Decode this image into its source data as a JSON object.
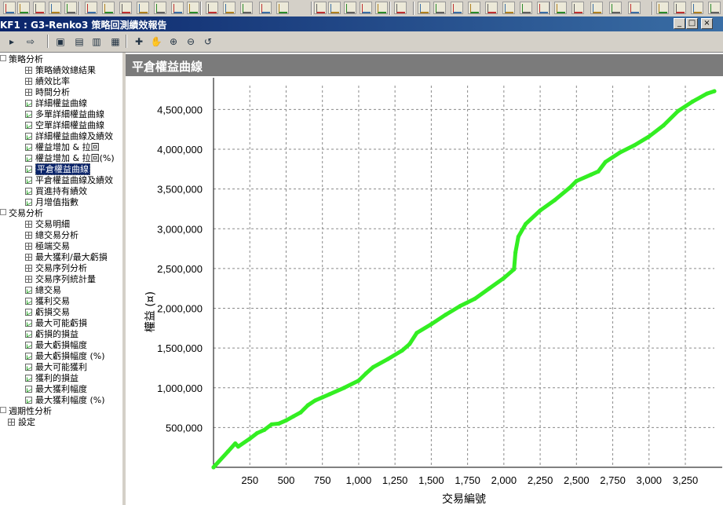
{
  "window": {
    "title": "KF1 : G3-Renko3 策略回測績效報告",
    "buttons": [
      "_",
      "□",
      "×"
    ]
  },
  "tree": {
    "items": [
      {
        "label": "策略分析",
        "level": 0,
        "icon": "expand-minus"
      },
      {
        "label": "策略績效總結果",
        "level": 1,
        "icon": "grid-icon"
      },
      {
        "label": "績效比率",
        "level": 1,
        "icon": "grid-icon"
      },
      {
        "label": "時間分析",
        "level": 1,
        "icon": "grid-icon"
      },
      {
        "label": "詳細權益曲線",
        "level": 1,
        "icon": "chart-icon"
      },
      {
        "label": "多單詳細權益曲線",
        "level": 1,
        "icon": "chart-icon"
      },
      {
        "label": "空單詳細權益曲線",
        "level": 1,
        "icon": "chart-icon"
      },
      {
        "label": "詳細權益曲線及績效",
        "level": 1,
        "icon": "chart-icon"
      },
      {
        "label": "權益增加 & 拉回",
        "level": 1,
        "icon": "chart-icon"
      },
      {
        "label": "權益增加 & 拉回(%)",
        "level": 1,
        "icon": "chart-icon"
      },
      {
        "label": "平倉權益曲線",
        "level": 1,
        "icon": "chart-icon",
        "selected": true
      },
      {
        "label": "平倉權益曲線及績效",
        "level": 1,
        "icon": "chart-icon"
      },
      {
        "label": "買進持有績效",
        "level": 1,
        "icon": "chart-icon"
      },
      {
        "label": "月增值指數",
        "level": 1,
        "icon": "chart-icon"
      },
      {
        "label": "交易分析",
        "level": 0,
        "icon": "expand-minus"
      },
      {
        "label": "交易明細",
        "level": 1,
        "icon": "grid-icon"
      },
      {
        "label": "總交易分析",
        "level": 1,
        "icon": "grid-icon"
      },
      {
        "label": "極端交易",
        "level": 1,
        "icon": "grid-icon"
      },
      {
        "label": "最大獲利/最大虧損",
        "level": 1,
        "icon": "grid-icon"
      },
      {
        "label": "交易序列分析",
        "level": 1,
        "icon": "grid-icon"
      },
      {
        "label": "交易序列統計量",
        "level": 1,
        "icon": "grid-icon"
      },
      {
        "label": "總交易",
        "level": 1,
        "icon": "chart-icon"
      },
      {
        "label": "獲利交易",
        "level": 1,
        "icon": "chart-icon"
      },
      {
        "label": "虧損交易",
        "level": 1,
        "icon": "chart-icon"
      },
      {
        "label": "最大可能虧損",
        "level": 1,
        "icon": "chart-icon"
      },
      {
        "label": "虧損的損益",
        "level": 1,
        "icon": "chart-icon"
      },
      {
        "label": "最大虧損幅度",
        "level": 1,
        "icon": "chart-icon"
      },
      {
        "label": "最大虧損幅度 (%)",
        "level": 1,
        "icon": "chart-icon"
      },
      {
        "label": "最大可能獲利",
        "level": 1,
        "icon": "chart-icon"
      },
      {
        "label": "獲利的損益",
        "level": 1,
        "icon": "chart-icon"
      },
      {
        "label": "最大獲利幅度",
        "level": 1,
        "icon": "chart-icon"
      },
      {
        "label": "最大獲利幅度 (%)",
        "level": 1,
        "icon": "chart-icon"
      },
      {
        "label": "週期性分析",
        "level": 0,
        "icon": "expand-plus"
      },
      {
        "label": "設定",
        "level": 0,
        "icon": "grid-icon"
      }
    ]
  },
  "panel": {
    "title": "平倉權益曲線"
  },
  "chart_data": {
    "type": "line",
    "title": "",
    "xlabel": "交易編號",
    "ylabel": "權益 (¤)",
    "xlim": [
      0,
      3450
    ],
    "ylim": [
      0,
      4800000
    ],
    "x_ticks": [
      250,
      500,
      750,
      1000,
      1250,
      1500,
      1750,
      2000,
      2250,
      2500,
      2750,
      3000,
      3250
    ],
    "x_tick_labels": [
      "250",
      "500",
      "750",
      "1,000",
      "1,250",
      "1,500",
      "1,750",
      "2,000",
      "2,250",
      "2,500",
      "2,750",
      "3,000",
      "3,250"
    ],
    "y_ticks": [
      500000,
      1000000,
      1500000,
      2000000,
      2500000,
      3000000,
      3500000,
      4000000,
      4500000
    ],
    "y_tick_labels": [
      "500,000",
      "1,000,000",
      "1,500,000",
      "2,000,000",
      "2,500,000",
      "3,000,000",
      "3,500,000",
      "4,000,000",
      "4,500,000"
    ],
    "grid": true,
    "color": "#33ee22",
    "series": [
      {
        "x": [
          0,
          100,
          150,
          170,
          250,
          300,
          350,
          400,
          450,
          500,
          550,
          600,
          650,
          700,
          750,
          800,
          900,
          1000,
          1050,
          1100,
          1200,
          1300,
          1350,
          1400,
          1500,
          1600,
          1700,
          1800,
          1900,
          2000,
          2070,
          2080,
          2100,
          2150,
          2250,
          2350,
          2450,
          2500,
          2600,
          2650,
          2700,
          2800,
          2900,
          3000,
          3100,
          3200,
          3300,
          3400,
          3450
        ],
        "y": [
          0,
          200000,
          300000,
          260000,
          360000,
          430000,
          470000,
          540000,
          550000,
          590000,
          640000,
          690000,
          780000,
          840000,
          880000,
          920000,
          1000000,
          1090000,
          1180000,
          1260000,
          1360000,
          1470000,
          1550000,
          1690000,
          1800000,
          1920000,
          2030000,
          2120000,
          2250000,
          2380000,
          2490000,
          2700000,
          2900000,
          3060000,
          3230000,
          3360000,
          3510000,
          3600000,
          3680000,
          3720000,
          3840000,
          3960000,
          4050000,
          4160000,
          4300000,
          4480000,
          4600000,
          4700000,
          4730000
        ]
      }
    ]
  }
}
